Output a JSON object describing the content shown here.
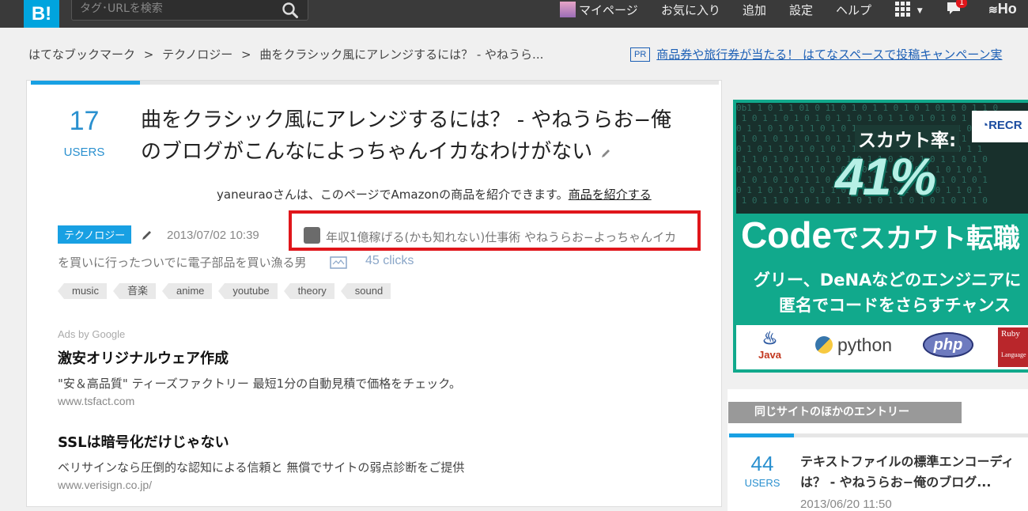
{
  "header": {
    "logo": "B!",
    "search_placeholder": "タグ･URLを検索",
    "nav": {
      "mypage": "マイページ",
      "favorites": "お気に入り",
      "add": "追加",
      "settings": "設定",
      "help": "ヘルプ",
      "notification_count": "1",
      "hotentry_partial": "Ho"
    }
  },
  "breadcrumb": {
    "items": [
      "はてなブックマーク",
      "テクノロジー",
      "曲をクラシック風にアレンジするには？ - やねうら..."
    ],
    "separator": ">"
  },
  "pr": {
    "badge": "PR",
    "text": "商品券や旅行券が当たる！ はてなスペースで投稿キャンペーン実"
  },
  "entry": {
    "users_count": "17",
    "users_label": "USERS",
    "title_line1": "曲をクラシック風にアレンジするには？ - やねうらお−俺",
    "title_line2": "のブログがこんなによっちゃんイカなわけがない",
    "amazon_text": "yaneuraoさんは、このページでAmazonの商品を紹介できます。",
    "amazon_link": "商品を紹介する",
    "category": "テクノロジー",
    "datetime": "2013/07/02 10:39",
    "comment_line1": "年収1億稼げる(かも知れない)仕事術 やねうらお−よっちゃんイカ",
    "comment_line2": "を買いに行ったついでに電子部品を買い漁る男",
    "clicks": "45 clicks",
    "tags": [
      "music",
      "音楽",
      "anime",
      "youtube",
      "theory",
      "sound"
    ]
  },
  "ads": {
    "label": "Ads by Google",
    "items": [
      {
        "title": "激安オリジナルウェア作成",
        "desc": "\"安＆高品質\" ティーズファクトリー 最短1分の自動見積で価格をチェック。",
        "url": "www.tsfact.com"
      },
      {
        "title": "SSLは暗号化だけじゃない",
        "desc": "ベリサインなら圧倒的な認知による信頼と 無償でサイトの弱点診断をご提供",
        "url": "www.verisign.co.jp/"
      }
    ]
  },
  "banner": {
    "scout_label": "スカウト率:",
    "scout_pct": "41%",
    "brand_partial": "RECR",
    "code_word": "Code",
    "code_rest": "でスカウト転職",
    "line1": "グリー、DeNAなどのエンジニアに",
    "line2": "匿名でコードをさらすチャンス",
    "logos": {
      "java": "Java",
      "python": "python",
      "php": "php",
      "ruby": "Ruby",
      "ruby_sub": "Language"
    }
  },
  "related": {
    "heading": "同じサイトのほかのエントリー",
    "items": [
      {
        "users_count": "44",
        "users_label": "USERS",
        "title_line1": "テキストファイルの標準エンコーディ",
        "title_line2": "は？ - やねうらお−俺のブログ...",
        "date": "2013/06/20 11:50"
      }
    ]
  },
  "colors": {
    "accent_blue": "#18a0e3",
    "highlight_red": "#e0161b",
    "banner_green": "#11a98c",
    "topbar": "#3a3a3a"
  }
}
